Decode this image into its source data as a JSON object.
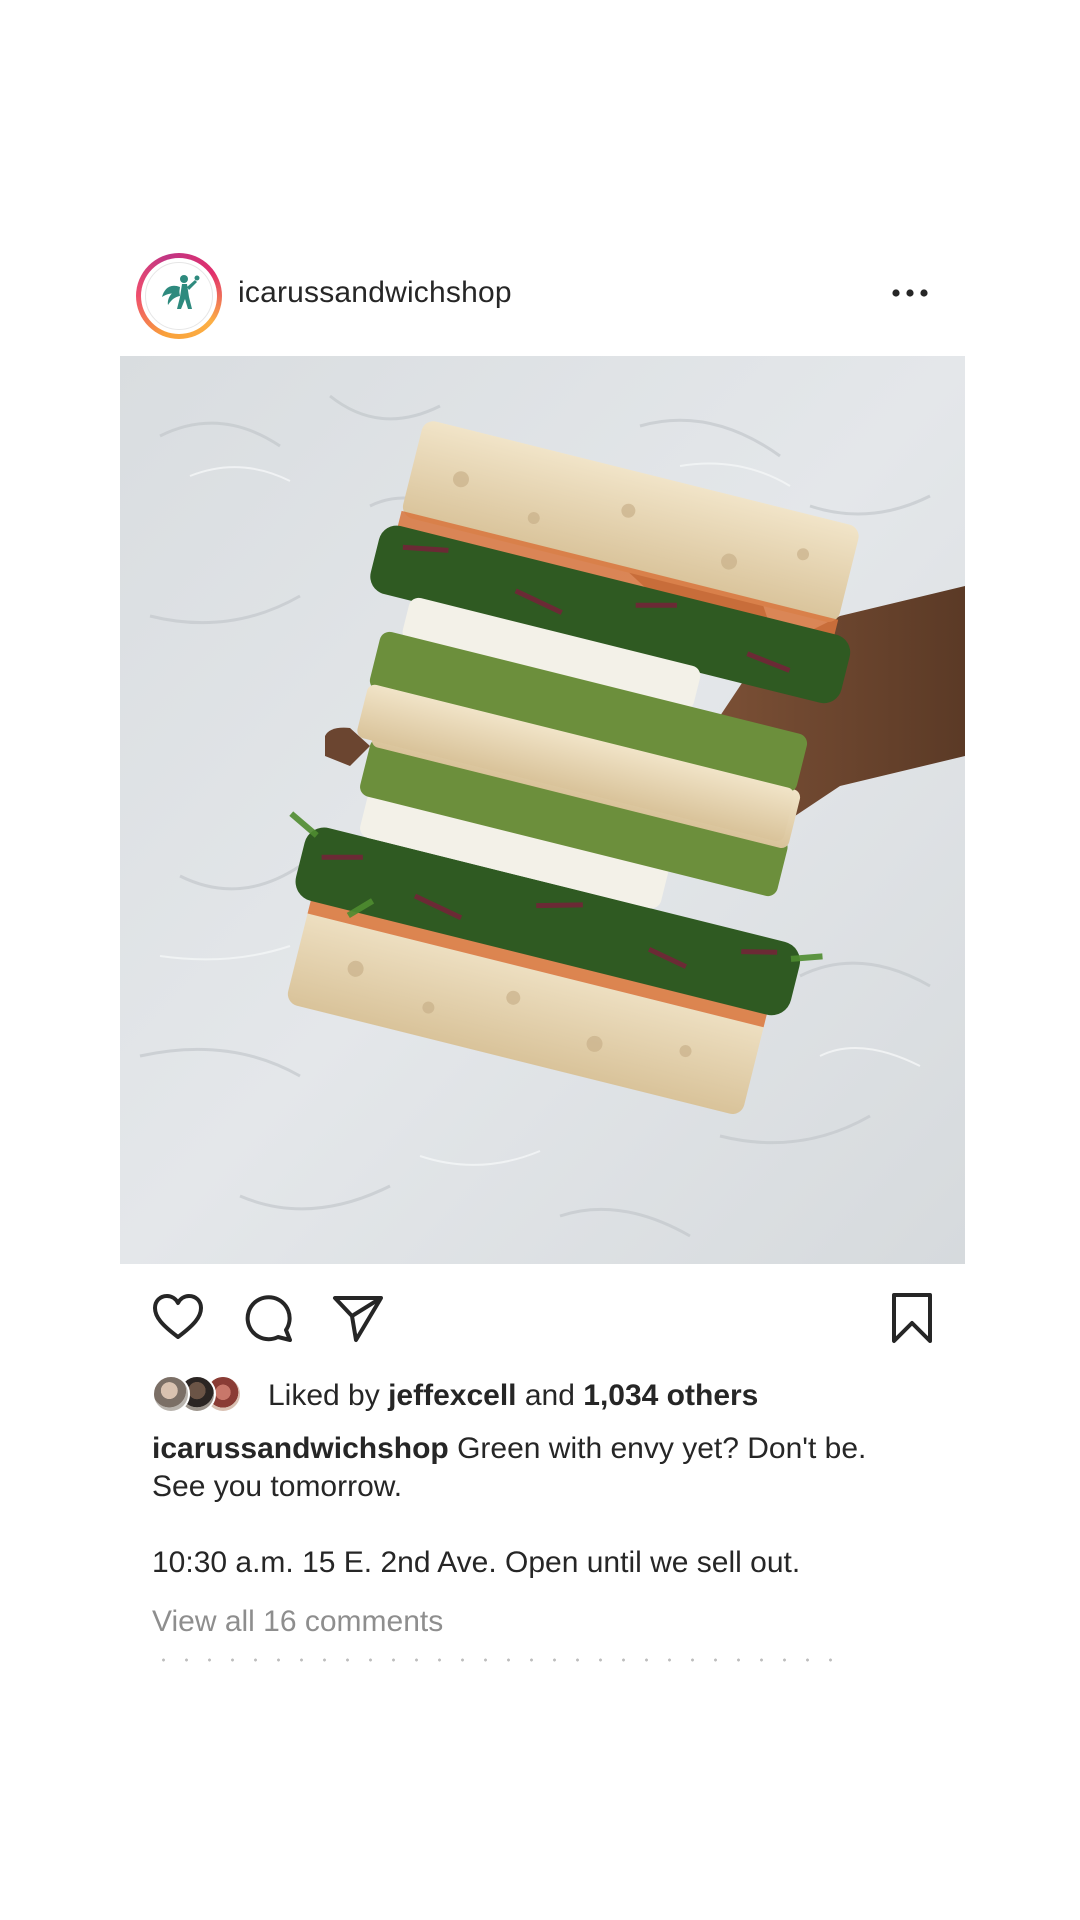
{
  "post": {
    "username": "icarussandwichshop",
    "more_icon": "more-horizontal-icon",
    "avatar_icon": "winged-figure-logo",
    "photo_alt": "photo",
    "actions": {
      "like_icon": "heart-icon",
      "comment_icon": "comment-icon",
      "share_icon": "send-icon",
      "save_icon": "bookmark-icon"
    },
    "likes": {
      "prefix": "Liked by",
      "user": "jeffexcell",
      "connector": "and",
      "others": "1,034 others"
    },
    "caption": {
      "username": "icarussandwichshop",
      "line1": "Green with envy yet? Don't be.",
      "line2": "See you tomorrow.",
      "line3": "10:30 a.m. 15 E. 2nd Ave. Open until we sell out."
    },
    "view_comments": "View all 16 comments"
  },
  "colors": {
    "text": "#262626",
    "muted": "#8e8e8e",
    "logo_teal": "#2e8a7e",
    "story_ring": [
      "#f9a13a",
      "#ee4d6e",
      "#c13584"
    ]
  }
}
